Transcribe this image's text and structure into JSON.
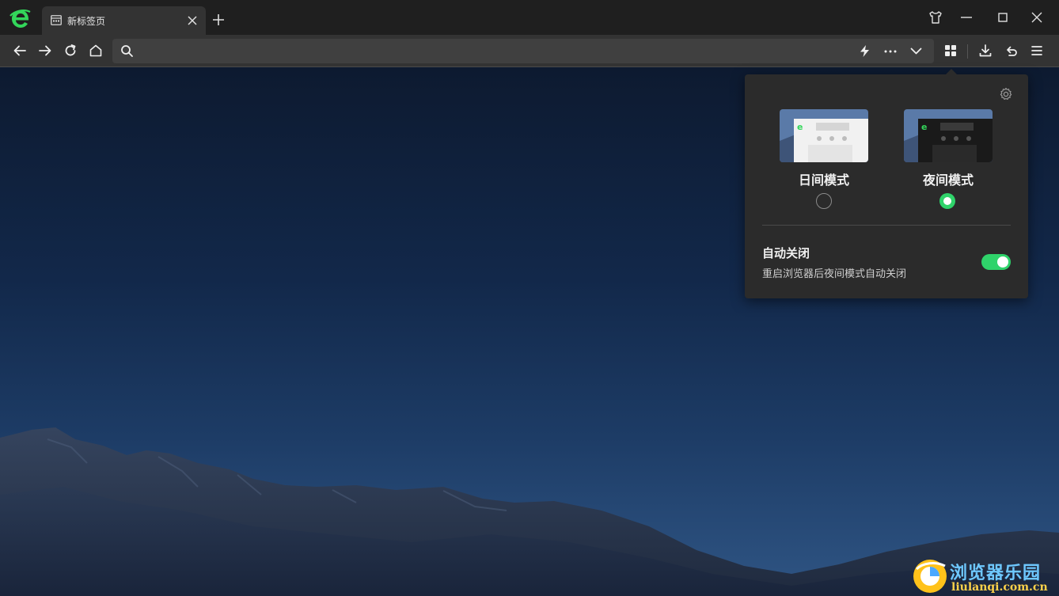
{
  "tab": {
    "title": "新标签页"
  },
  "address_bar": {
    "value": "",
    "placeholder": ""
  },
  "night_panel": {
    "day_mode_label": "日间模式",
    "night_mode_label": "夜间模式",
    "selected_mode": "夜间模式",
    "auto_close": {
      "title": "自动关闭",
      "description": "重启浏览器后夜间模式自动关闭",
      "enabled": true
    }
  },
  "watermark": {
    "name": "浏览器乐园",
    "url": "liulanqi.com.cn"
  },
  "colors": {
    "accent_green": "#2fd36a",
    "titlebar": "#1f1f1f",
    "toolbar": "#333333",
    "panel": "#2b2b2b"
  },
  "icons": {
    "titlebar": [
      "browser-logo-icon",
      "tab-page-icon",
      "close-icon",
      "plus-icon",
      "skin-shirt-icon",
      "minimize-icon",
      "maximize-icon",
      "window-close-icon"
    ],
    "toolbar": [
      "back-arrow-icon",
      "forward-arrow-icon",
      "refresh-icon",
      "home-icon",
      "search-icon",
      "lightning-icon",
      "more-dots-icon",
      "chevron-down-icon",
      "apps-grid-icon",
      "download-icon",
      "undo-icon",
      "menu-icon"
    ],
    "panel": [
      "gear-icon"
    ]
  }
}
